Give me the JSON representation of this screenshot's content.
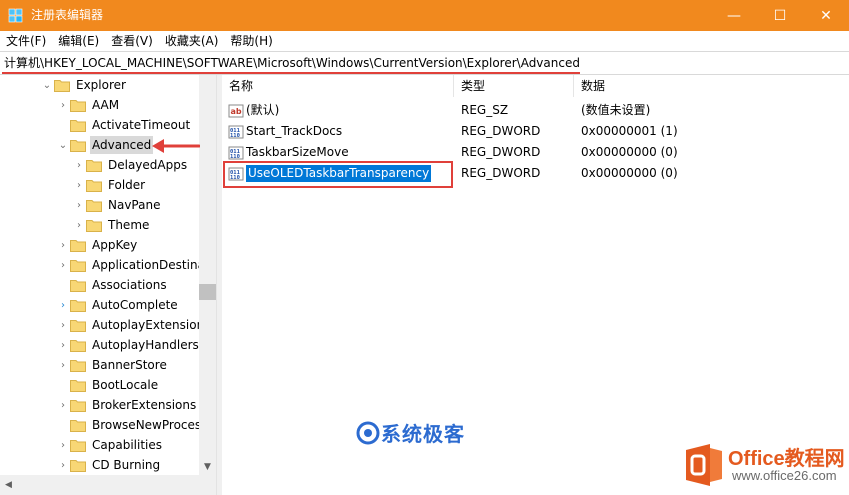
{
  "window": {
    "title": "注册表编辑器",
    "min_glyph": "—",
    "max_glyph": "☐",
    "close_glyph": "✕",
    "accent_color": "#f1891e"
  },
  "menu": {
    "items": [
      "文件(F)",
      "编辑(E)",
      "查看(V)",
      "收藏夹(A)",
      "帮助(H)"
    ]
  },
  "address": {
    "path": "计算机\\HKEY_LOCAL_MACHINE\\SOFTWARE\\Microsoft\\Windows\\CurrentVersion\\Explorer\\Advanced"
  },
  "tree": {
    "items": [
      {
        "label": "Explorer",
        "chevron": "⌄"
      },
      {
        "label": "AAM",
        "chevron": "›"
      },
      {
        "label": "ActivateTimeout",
        "chevron": ""
      },
      {
        "label": "Advanced",
        "chevron": "⌄"
      },
      {
        "label": "DelayedApps",
        "chevron": "›"
      },
      {
        "label": "Folder",
        "chevron": "›"
      },
      {
        "label": "NavPane",
        "chevron": "›"
      },
      {
        "label": "Theme",
        "chevron": "›"
      },
      {
        "label": "AppKey",
        "chevron": "›"
      },
      {
        "label": "ApplicationDestina",
        "chevron": "›"
      },
      {
        "label": "Associations",
        "chevron": ""
      },
      {
        "label": "AutoComplete",
        "chevron": "›"
      },
      {
        "label": "AutoplayExtension",
        "chevron": "›"
      },
      {
        "label": "AutoplayHandlers",
        "chevron": "›"
      },
      {
        "label": "BannerStore",
        "chevron": "›"
      },
      {
        "label": "BootLocale",
        "chevron": ""
      },
      {
        "label": "BrokerExtensions",
        "chevron": "›"
      },
      {
        "label": "BrowseNewProces",
        "chevron": ""
      },
      {
        "label": "Capabilities",
        "chevron": "›"
      },
      {
        "label": "CD Burning",
        "chevron": "›"
      }
    ]
  },
  "list": {
    "headers": {
      "name": "名称",
      "type": "类型",
      "data": "数据"
    },
    "rows": [
      {
        "name": "(默认)",
        "type": "REG_SZ",
        "data": "(数值未设置)",
        "icon": "string-value-icon"
      },
      {
        "name": "Start_TrackDocs",
        "type": "REG_DWORD",
        "data": "0x00000001 (1)",
        "icon": "dword-value-icon"
      },
      {
        "name": "TaskbarSizeMove",
        "type": "REG_DWORD",
        "data": "0x00000000 (0)",
        "icon": "dword-value-icon"
      },
      {
        "name": "UseOLEDTaskbarTransparency",
        "type": "REG_DWORD",
        "data": "0x00000000 (0)",
        "icon": "dword-value-icon"
      }
    ]
  },
  "watermarks": {
    "system": "系统极客",
    "office_name": "Office教程网",
    "office_url": "www.office26.com"
  },
  "colors": {
    "selection": "#0078d7",
    "annotation_red": "#e0403a",
    "folder_yellow": "#f8d775"
  }
}
